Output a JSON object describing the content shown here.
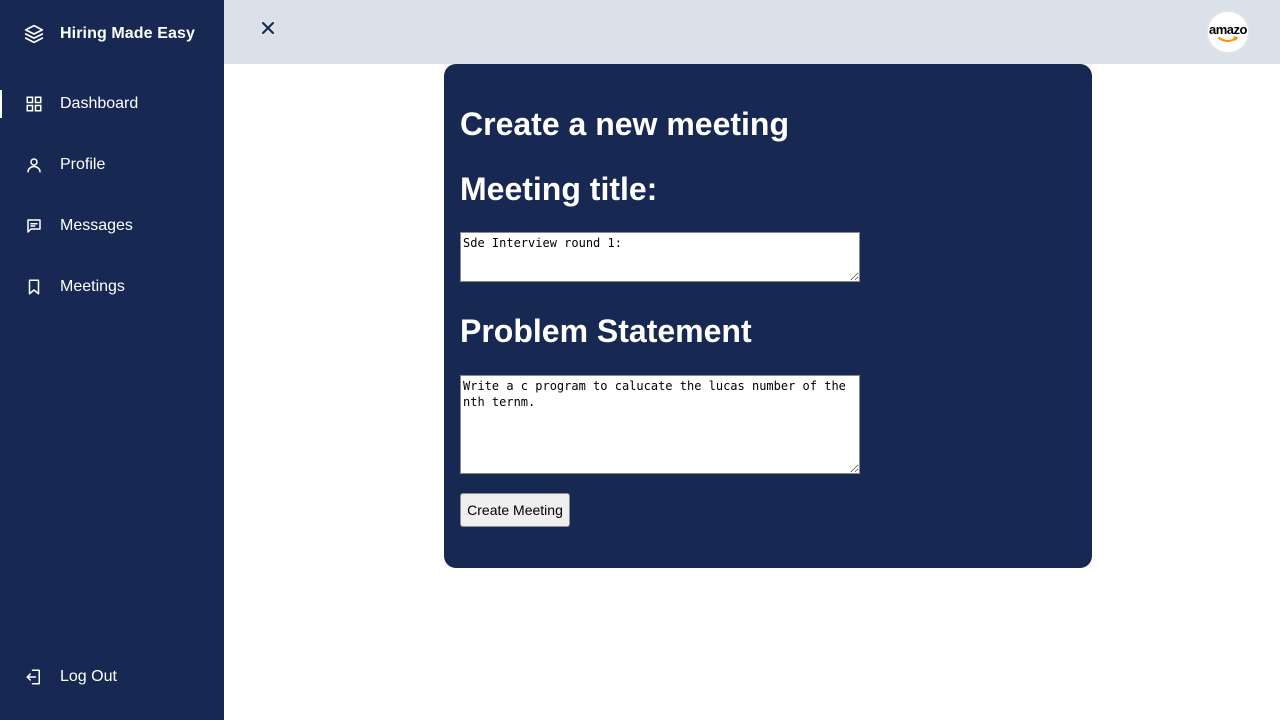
{
  "sidebar": {
    "brand": "Hiring Made Easy",
    "items": [
      {
        "label": "Dashboard",
        "icon": "grid-icon"
      },
      {
        "label": "Profile",
        "icon": "user-icon"
      },
      {
        "label": "Messages",
        "icon": "message-icon"
      },
      {
        "label": "Meetings",
        "icon": "bookmark-icon"
      }
    ],
    "logout_label": "Log Out"
  },
  "topbar": {
    "close_icon": "close-icon",
    "avatar_text": "amazo"
  },
  "form": {
    "heading": "Create a new meeting",
    "meeting_title_label": "Meeting title:",
    "meeting_title_value": "Sde Interview round 1:",
    "problem_label": "Problem Statement",
    "problem_value": "Write a c program to calucate the lucas number of the nth ternm.",
    "submit_label": "Create Meeting"
  },
  "colors": {
    "sidebar_bg": "#172852",
    "topbar_bg": "#dbe1e8",
    "card_bg": "#172852"
  }
}
